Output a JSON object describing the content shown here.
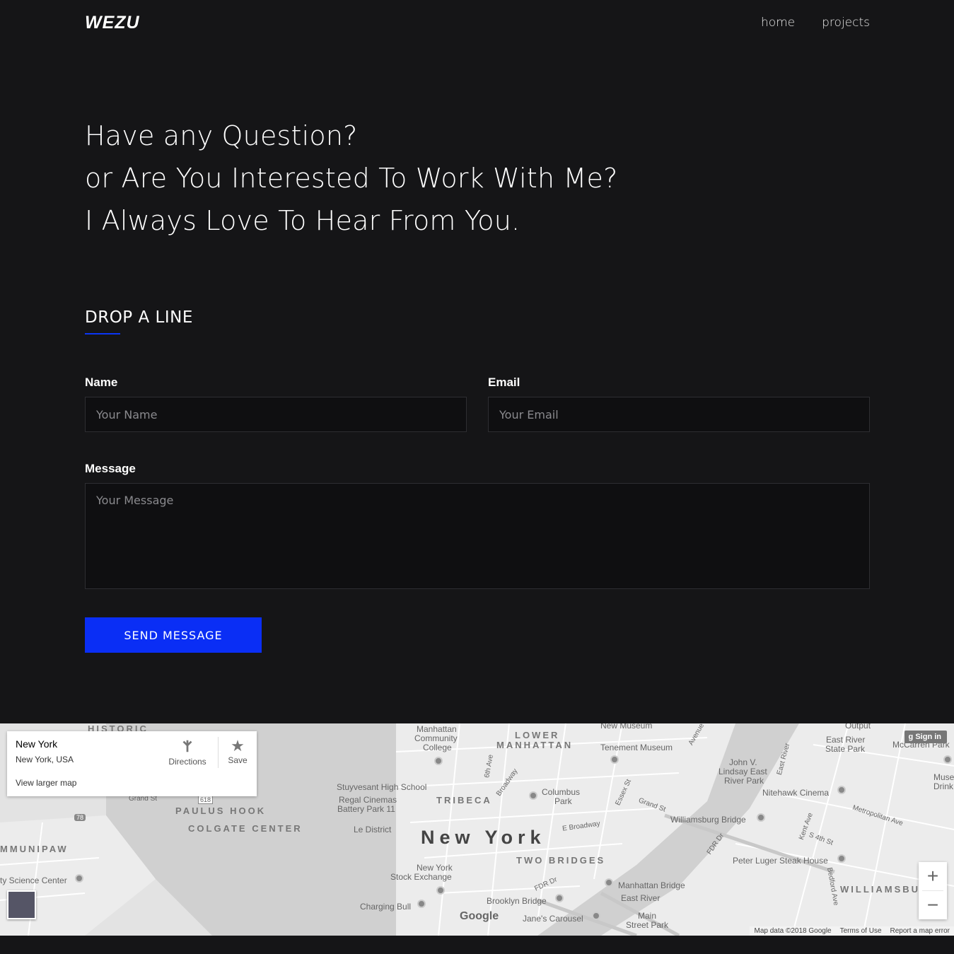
{
  "header": {
    "logo": "WEZU",
    "nav": [
      {
        "label": "home"
      },
      {
        "label": "projects"
      }
    ]
  },
  "hero": {
    "lines": [
      "Have any Question?",
      "or Are You Interested To Work With Me?",
      "I Always Love To Hear From You."
    ]
  },
  "contact": {
    "title": "DROP A LINE",
    "accent_color": "#0a2ef5",
    "name_label": "Name",
    "name_placeholder": "Your Name",
    "email_label": "Email",
    "email_placeholder": "Your Email",
    "message_label": "Message",
    "message_placeholder": "Your Message",
    "send_label": "SEND MESSAGE"
  },
  "map": {
    "place_title": "New York",
    "place_subtitle": "New York, USA",
    "view_larger": "View larger map",
    "directions_label": "Directions",
    "save_label": "Save",
    "signin_label": "Sign in",
    "google_logo": "Google",
    "attribution": [
      "Map data ©2018 Google",
      "Terms of Use",
      "Report a map error"
    ],
    "labels": {
      "new_york": "New York",
      "lower_manhattan": "LOWER",
      "manhattan": "MANHATTAN",
      "tribeca": "TRIBECA",
      "two_bridges": "TWO BRIDGES",
      "paulus_hook": "PAULUS HOOK",
      "colgate_center": "COLGATE CENTER",
      "historic": "HISTORIC",
      "communipaw": "MMUNIPAW",
      "williamsburg": "WILLIAMSBU",
      "tenement_museum": "Tenement Museum",
      "stuyvesant": "Stuyvesant High School",
      "regal": "Regal Cinemas",
      "battery_park": "Battery Park 11",
      "le_district": "Le District",
      "columbus_park": "Columbus",
      "columbus_park2": "Park",
      "stock_exchange": "New York",
      "stock_exchange2": "Stock Exchange",
      "charging_bull": "Charging Bull",
      "brooklyn_bridge": "Brooklyn Bridge",
      "janes_carousel": "Jane's Carousel",
      "main_street_park": "Main",
      "main_street_park2": "Street Park",
      "manhattan_bridge": "Manhattan Bridge",
      "east_river": "East River",
      "williamsburg_bridge": "Williamsburg Bridge",
      "nitehawk": "Nitehawk Cinema",
      "peter_luger": "Peter Luger Steak House",
      "john_lindsay": "John V.",
      "john_lindsay2": "Lindsay East",
      "john_lindsay3": "River Park",
      "east_river_state": "East River",
      "east_river_state2": "State Park",
      "science_center": "ty Science Center",
      "manhattan_college": "Manhattan",
      "manhattan_college2": "Community",
      "manhattan_college3": "College",
      "grand_st": "Grand St",
      "grand_st2": "Grand St",
      "e_broadway": "E Broadway",
      "fdr": "FDR Dr",
      "fdr2": "FDR Dr",
      "metropolitan": "Metropolitan Ave",
      "s4th": "S 4th St",
      "kent": "Kent Ave",
      "bedford": "Bedford Ave",
      "sixth_ave": "6th Ave",
      "broadway": "Broadway",
      "essex": "Essex St",
      "avenue": "Avenue",
      "east_river_label": "East River",
      "route_618": "618",
      "route_78": "78",
      "new_museum": "New Museum",
      "outpu": "Output",
      "mccarren": "McCarren Park",
      "muse": "Muse",
      "drink": "Drink"
    }
  }
}
